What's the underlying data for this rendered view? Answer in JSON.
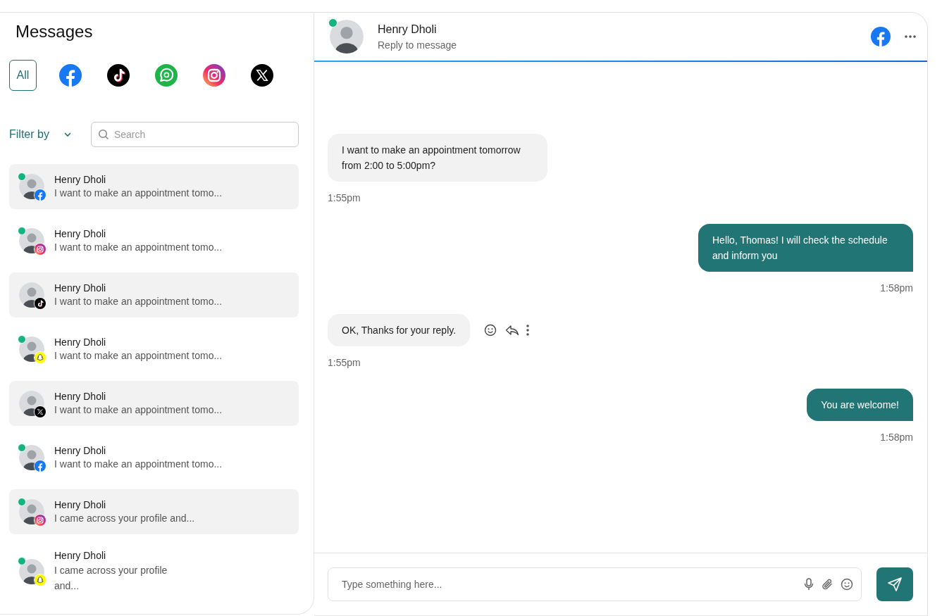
{
  "sidebar": {
    "title": "Messages",
    "platform_tabs": [
      {
        "kind": "all",
        "label": "All",
        "selected": true
      },
      {
        "kind": "facebook",
        "selected": false
      },
      {
        "kind": "tiktok",
        "selected": false
      },
      {
        "kind": "whatsapp-business",
        "selected": false
      },
      {
        "kind": "instagram",
        "selected": false
      },
      {
        "kind": "x",
        "selected": false
      }
    ],
    "filter_label": "Filter by",
    "search": {
      "placeholder": "Search"
    }
  },
  "conversations": [
    {
      "name": "Henry Dholi",
      "preview": "I want to make an appointment tomo...",
      "online": true,
      "kind": "facebook"
    },
    {
      "name": "Henry Dholi",
      "preview": "I want to make an appointment tomo...",
      "online": true,
      "kind": "instagram"
    },
    {
      "name": "Henry Dholi",
      "preview": "I want to make an appointment tomo...",
      "online": false,
      "kind": "tiktok"
    },
    {
      "name": "Henry Dholi",
      "preview": "I want to make an appointment tomo...",
      "online": true,
      "kind": "snapchat"
    },
    {
      "name": "Henry Dholi",
      "preview": "I want to make an appointment tomo...",
      "online": false,
      "kind": "x"
    },
    {
      "name": "Henry Dholi",
      "preview": "I want to make an appointment tomo...",
      "online": true,
      "kind": "facebook"
    },
    {
      "name": "Henry Dholi",
      "preview": "I came across your profile and...",
      "online": true,
      "kind": "instagram"
    },
    {
      "name": "Henry Dholi",
      "preview": "I came across your profile\nand...",
      "online": true,
      "kind": "snapchat"
    }
  ],
  "chat": {
    "header": {
      "name": "Henry Dholi",
      "subtitle": "Reply to message",
      "online": true,
      "kind": "facebook"
    },
    "messages": [
      {
        "kind": "incoming",
        "text": "I want to make an appointment tomorrow from 2:00 to 5:00pm?",
        "time": "1:55pm",
        "actions": false
      },
      {
        "kind": "outgoing",
        "text": "Hello, Thomas! I will check the schedule and inform you",
        "time": "1:58pm",
        "actions": false
      },
      {
        "kind": "incoming",
        "text": "OK, Thanks for your reply.",
        "time": "1:55pm",
        "actions": true
      },
      {
        "kind": "outgoing",
        "text": "You are welcome!",
        "time": "1:58pm",
        "actions": false
      }
    ],
    "composer": {
      "placeholder": "Type something here..."
    }
  }
}
